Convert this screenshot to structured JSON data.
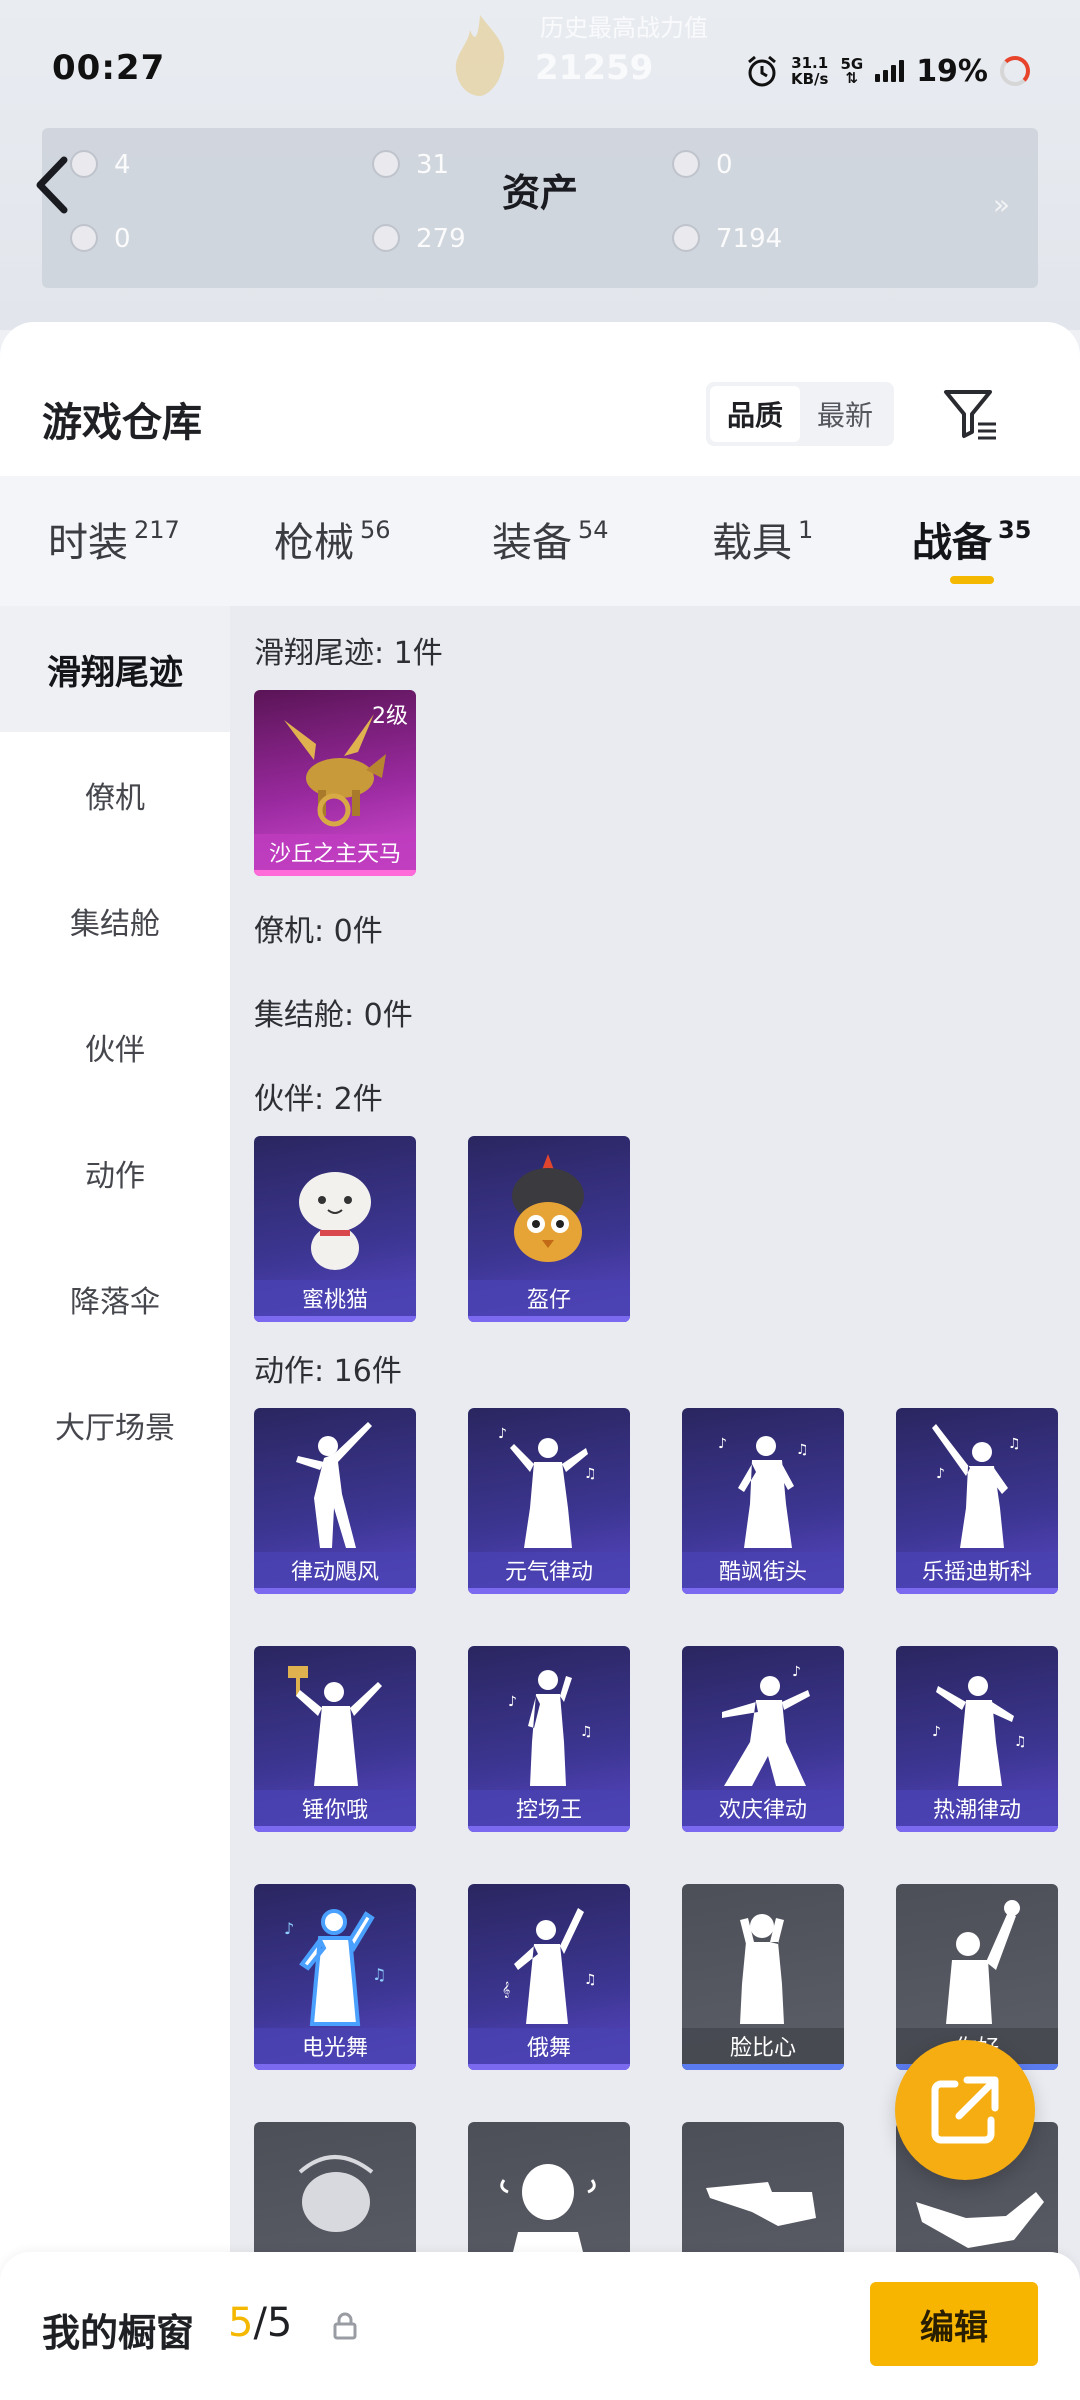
{
  "status_bar": {
    "time": "00:27",
    "net_speed_value": "31.1",
    "net_speed_unit": "KB/s",
    "network": "5G",
    "battery": "19%"
  },
  "header": {
    "ghost_subtitle": "历史最高战力值",
    "ghost_score": "21259"
  },
  "assets": {
    "title": "资产",
    "items": [
      {
        "value": "4"
      },
      {
        "value": "31"
      },
      {
        "value": "0"
      },
      {
        "value": "0"
      },
      {
        "value": "279"
      },
      {
        "value": "7194"
      }
    ]
  },
  "warehouse": {
    "title": "游戏仓库",
    "sort_options": [
      "品质",
      "最新"
    ],
    "tabs": [
      {
        "label": "时装",
        "count": "217"
      },
      {
        "label": "枪械",
        "count": "56"
      },
      {
        "label": "装备",
        "count": "54"
      },
      {
        "label": "载具",
        "count": "1"
      },
      {
        "label": "战备",
        "count": "35"
      }
    ],
    "sidebar": [
      "滑翔尾迹",
      "僚机",
      "集结舱",
      "伙伴",
      "动作",
      "降落伞",
      "大厅场景"
    ],
    "sections": {
      "trail": {
        "title": "滑翔尾迹: 1件",
        "items": [
          {
            "name": "沙丘之主天马",
            "level": "2级"
          }
        ]
      },
      "wingman": {
        "title": "僚机: 0件"
      },
      "pod": {
        "title": "集结舱: 0件"
      },
      "partner": {
        "title": "伙伴: 2件",
        "items": [
          {
            "name": "蜜桃猫"
          },
          {
            "name": "盔仔"
          }
        ]
      },
      "emote": {
        "title": "动作: 16件",
        "items": [
          {
            "name": "律动飓风"
          },
          {
            "name": "元气律动"
          },
          {
            "name": "酷飒街头"
          },
          {
            "name": "乐摇迪斯科"
          },
          {
            "name": "锤你哦"
          },
          {
            "name": "控场王"
          },
          {
            "name": "欢庆律动"
          },
          {
            "name": "热潮律动"
          },
          {
            "name": "电光舞"
          },
          {
            "name": "俄舞"
          },
          {
            "name": "脸比心"
          },
          {
            "name": "你好"
          }
        ]
      }
    }
  },
  "bottom_bar": {
    "label": "我的橱窗",
    "count_current": "5",
    "count_total": "/5",
    "edit_label": "编辑"
  }
}
